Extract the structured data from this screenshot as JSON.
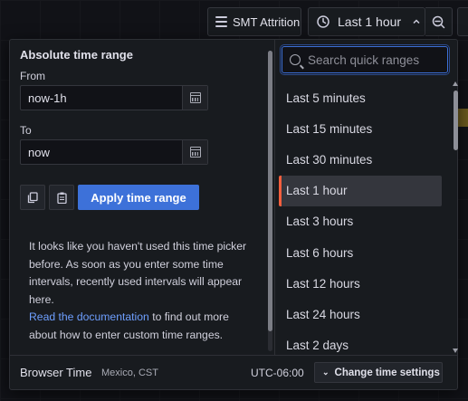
{
  "toolbar": {
    "dashboard_label": "SMT Attrition",
    "time_range_label": "Last 1 hour"
  },
  "picker": {
    "title": "Absolute time range",
    "from_label": "From",
    "from_value": "now-1h",
    "to_label": "To",
    "to_value": "now",
    "apply_label": "Apply time range",
    "help_text_1": "It looks like you haven't used this time picker before. As soon as you enter some time intervals, recently used intervals will appear here.",
    "help_link": "Read the documentation",
    "help_text_2": " to find out more about how to enter custom time ranges.",
    "search_placeholder": "Search quick ranges",
    "quick_ranges": [
      "Last 5 minutes",
      "Last 15 minutes",
      "Last 30 minutes",
      "Last 1 hour",
      "Last 3 hours",
      "Last 6 hours",
      "Last 12 hours",
      "Last 24 hours",
      "Last 2 days"
    ],
    "active_range_index": 3,
    "footer": {
      "label": "Browser Time",
      "timezone": "Mexico, CST",
      "offset": "UTC-06:00",
      "change_settings_label": "Change time settings"
    }
  },
  "colors": {
    "accent": "#3d71d9",
    "active_marker": "#f55f3e",
    "link": "#6e9fff",
    "panel_bg": "#181b1f"
  }
}
